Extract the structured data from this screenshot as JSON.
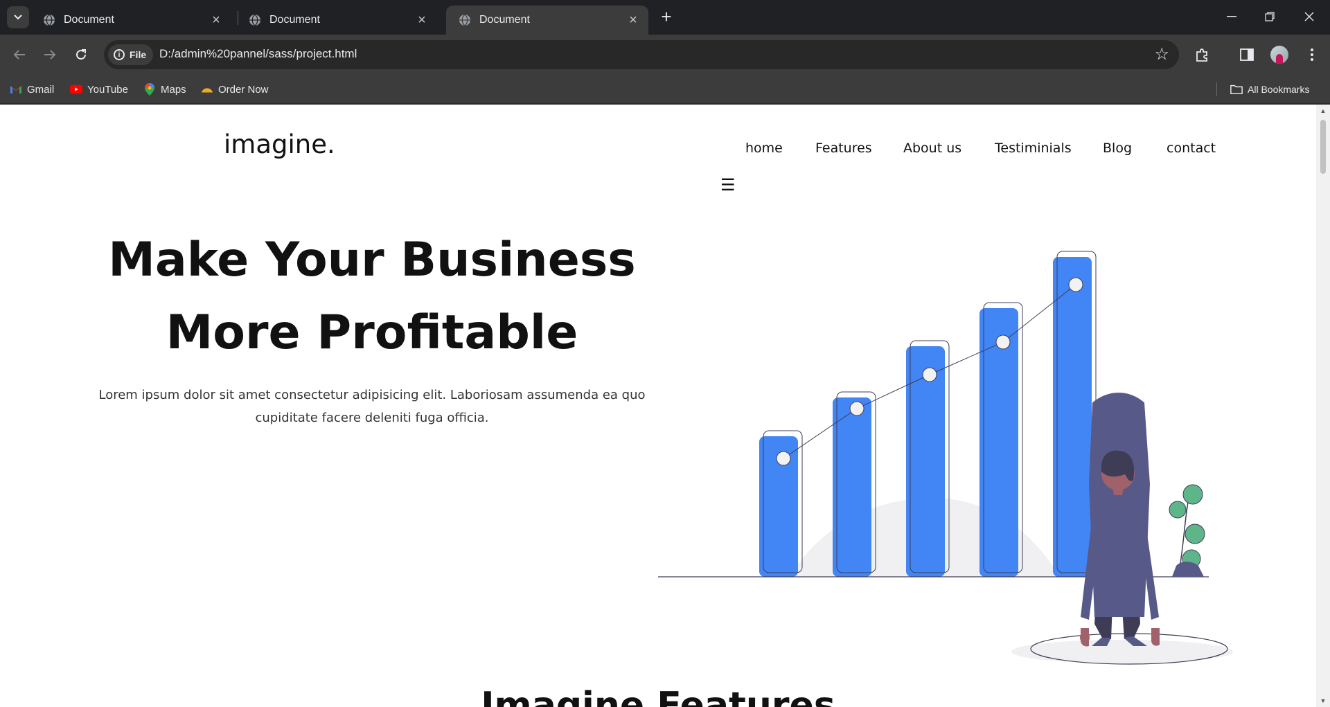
{
  "browser": {
    "tabs": [
      {
        "title": "Document",
        "active": false
      },
      {
        "title": "Document",
        "active": false
      },
      {
        "title": "Document",
        "active": true
      }
    ],
    "address": {
      "scheme_chip": "File",
      "url": "D:/admin%20pannel/sass/project.html"
    },
    "bookmarks": [
      "Gmail",
      "YouTube",
      "Maps",
      "Order Now"
    ],
    "all_bookmarks": "All Bookmarks"
  },
  "page": {
    "logo": "imagine.",
    "nav": [
      "home",
      "Features",
      "About us",
      "Testiminials",
      "Blog",
      "contact"
    ],
    "menu_icon": "☰",
    "hero": {
      "title_line1": "Make Your Business",
      "title_line2": "More Profitable",
      "text": "Lorem ipsum dolor sit amet consectetur adipisicing elit. Laboriosam assumenda ea quo cupiditate facere deleniti fuga officia."
    },
    "features_title": "Imagine Features",
    "illustration": {
      "bar_color": "#4285f4",
      "figure_color": "#575a89",
      "plant_color": "#5fb58a",
      "relative_bar_heights": [
        0.44,
        0.56,
        0.72,
        0.84,
        1.0
      ]
    }
  }
}
